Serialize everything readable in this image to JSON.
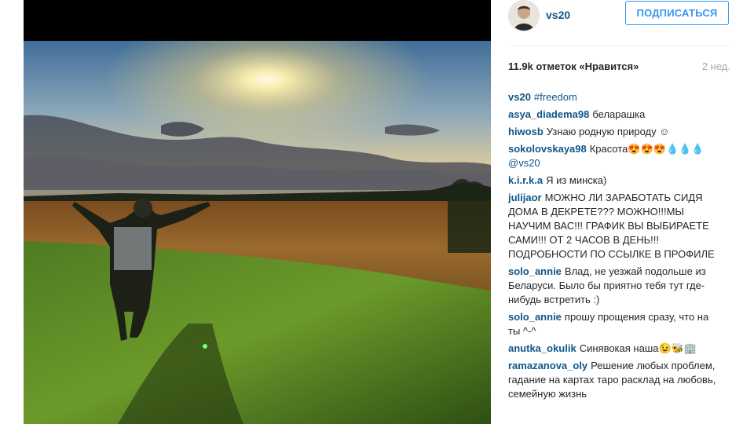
{
  "post": {
    "author": "vs20",
    "follow_label": "ПОДПИСАТЬСЯ",
    "likes": "11.9k отметок «Нравится»",
    "time_ago": "2 нед.",
    "caption": {
      "author": "vs20",
      "text": "#freedom"
    }
  },
  "comments": [
    {
      "author": "asya_diadema98",
      "text": "беларашка"
    },
    {
      "author": "hiwosb",
      "text": "Узнаю родную природу ☺"
    },
    {
      "author": "sokolovskaya98",
      "text": "Красота😍😍😍💧💧💧",
      "mention": "@vs20"
    },
    {
      "author": "k.i.r.k.a",
      "text": "Я из минска)"
    },
    {
      "author": "julijaor",
      "text": "МОЖНО ЛИ ЗАРАБОТАТЬ СИДЯ ДОМА В ДЕКРЕТЕ??? МОЖНО!!!МЫ НАУЧИМ ВАС!!! ГРАФИК ВЫ ВЫБИРАЕТЕ САМИ!!! ОТ 2 ЧАСОВ В ДЕНЬ!!! ПОДРОБНОСТИ ПО ССЫЛКЕ В ПРОФИЛЕ"
    },
    {
      "author": "solo_annie",
      "text": "Влад, не уезжай подольше из Беларуси. Было бы приятно тебя тут где-нибудь встретить :)"
    },
    {
      "author": "solo_annie",
      "text": "прошу прощения сразу, что на ты ^-^"
    },
    {
      "author": "anutka_okulik",
      "text": "Синявокая наша😉🐝🏢"
    },
    {
      "author": "ramazanova_oly",
      "text": "Решение любых проблем, гадание на картах таро расклад на любовь, семейную жизнь"
    }
  ]
}
